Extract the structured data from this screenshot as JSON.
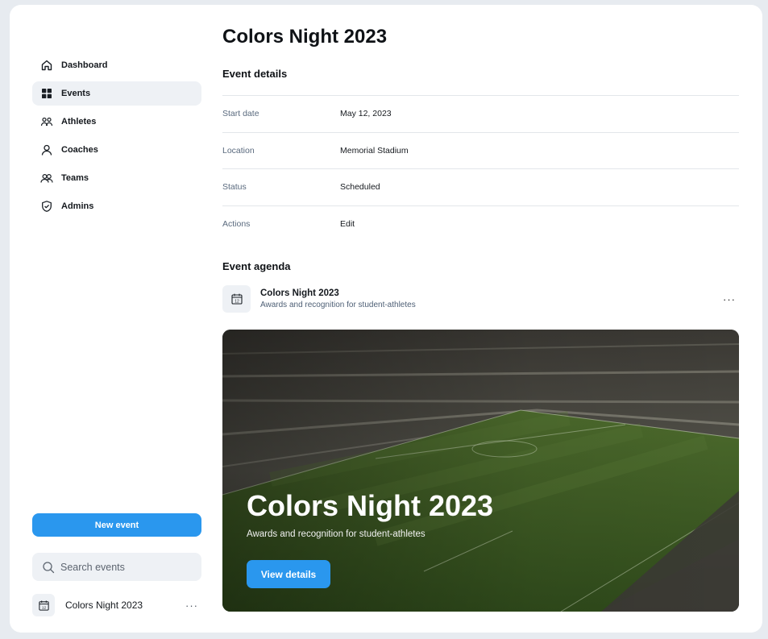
{
  "sidebar": {
    "items": [
      {
        "label": "Dashboard",
        "icon": "home-icon"
      },
      {
        "label": "Events",
        "icon": "grid-icon",
        "active": true
      },
      {
        "label": "Athletes",
        "icon": "users-icon"
      },
      {
        "label": "Coaches",
        "icon": "user-icon"
      },
      {
        "label": "Teams",
        "icon": "team-icon"
      },
      {
        "label": "Admins",
        "icon": "shield-icon"
      }
    ],
    "new_event_label": "New event",
    "search_placeholder": "Search events",
    "event_item": {
      "name": "Colors Night 2023",
      "icon": "calendar-icon",
      "calendar_day": "12"
    }
  },
  "main": {
    "title": "Colors Night 2023",
    "details_heading": "Event details",
    "details": [
      {
        "key": "Start date",
        "value": "May 12, 2023"
      },
      {
        "key": "Location",
        "value": "Memorial Stadium"
      },
      {
        "key": "Status",
        "value": "Scheduled"
      },
      {
        "key": "Actions",
        "value": "Edit"
      }
    ],
    "agenda_heading": "Event agenda",
    "agenda_item": {
      "title": "Colors Night 2023",
      "subtitle": "Awards and recognition for student-athletes",
      "calendar_day": "12"
    },
    "hero": {
      "title": "Colors Night 2023",
      "subtitle": "Awards and recognition for student-athletes",
      "button_label": "View details"
    }
  },
  "colors": {
    "accent": "#2a97ee",
    "active_nav_bg": "#eef1f5",
    "page_bg": "#e7ebf0"
  }
}
